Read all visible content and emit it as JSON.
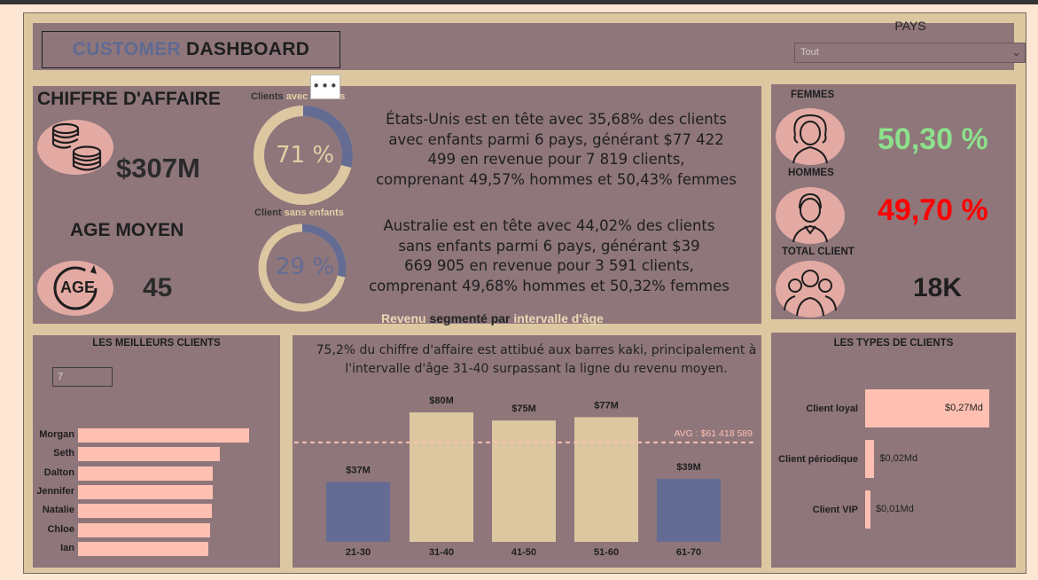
{
  "header": {
    "title_part1": "CUSTOMER",
    "title_part2": "DASHBOARD",
    "pays_label": "PAYS",
    "pays_value": "Tout"
  },
  "kpis": {
    "ca_title": "CHIFFRE D'AFFAIRE",
    "ca_value": "$307M",
    "age_title": "AGE MOYEN",
    "age_value": "45",
    "age_icon_text": "AGE"
  },
  "donuts": {
    "with_children": {
      "label_a": "Clients ",
      "label_b": "avec enfants",
      "value": "71 %",
      "fraction": 0.71
    },
    "without_children": {
      "label_a": "Client ",
      "label_b": "sans enfants",
      "value": "29 %",
      "fraction": 0.29
    },
    "more_label": "•••"
  },
  "narrative": {
    "para1": [
      "États-Unis est en tête avec 35,68% des clients",
      "avec enfants parmi 6 pays, générant $77 422",
      "499 en revenue pour 7 819 clients,",
      "comprenant 49,57% hommes et 50,43% femmes"
    ],
    "para2": [
      "Australie est en tête avec 44,02% des clients",
      "sans enfants parmi 6 pays, générant $39",
      "669 905 en revenue pour 3 591 clients,",
      "comprenant 49,68% hommes et 50,32% femmes"
    ]
  },
  "gender": {
    "femmes_label": "FEMMES",
    "femmes_value": "50,30 %",
    "hommes_label": "HOMMES",
    "hommes_value": "49,70 %",
    "total_label": "TOTAL CLIENT",
    "total_value": "18K"
  },
  "best_clients": {
    "title": "LES MEILLEURS CLIENTS",
    "top_n": "7",
    "names": [
      "Morgan",
      "Seth",
      "Dalton",
      "Jennifer",
      "Natalie",
      "Chloe",
      "Ian"
    ],
    "scores": [
      1.0,
      0.83,
      0.79,
      0.79,
      0.78,
      0.77,
      0.76
    ]
  },
  "chart_header": {
    "sub_a": "Revenu",
    "sub_b": " segmenté par ",
    "sub_c": " intervalle d'âge",
    "note": [
      "75,2% du chiffre d'affaire est attibué aux barres kaki, principalement à",
      "l'intervalle d'âge 31-40 surpassant la ligne du revenu moyen."
    ]
  },
  "chart_data": {
    "type": "bar",
    "categories": [
      "21-30",
      "31-40",
      "41-50",
      "51-60",
      "61-70"
    ],
    "values": [
      37,
      80,
      75,
      77,
      39
    ],
    "labels": [
      "$37M",
      "$80M",
      "$75M",
      "$77M",
      "$39M"
    ],
    "units": "$M",
    "avg_value": 61.418589,
    "avg_label": "AVG : $61 418 589",
    "colors": {
      "below_avg": "#646c93",
      "above_avg": "#dcc7a1",
      "avg_line": "#ffc0b1"
    },
    "ylim": [
      0,
      80
    ]
  },
  "client_types": {
    "title": "LES TYPES DE CLIENTS",
    "items": [
      {
        "name": "Client loyal",
        "value": "$0,27Md",
        "amount": 0.27
      },
      {
        "name": "Client périodique",
        "value": "$0,02Md",
        "amount": 0.02
      },
      {
        "name": "Client VIP",
        "value": "$0,01Md",
        "amount": 0.01
      }
    ]
  },
  "colors": {
    "panel": "#8e767b",
    "frame": "#dcc7a1",
    "accent_blue": "#646c93",
    "salmon": "#ffc0b1",
    "female_green": "#8de08b",
    "male_red": "#ff0000"
  }
}
